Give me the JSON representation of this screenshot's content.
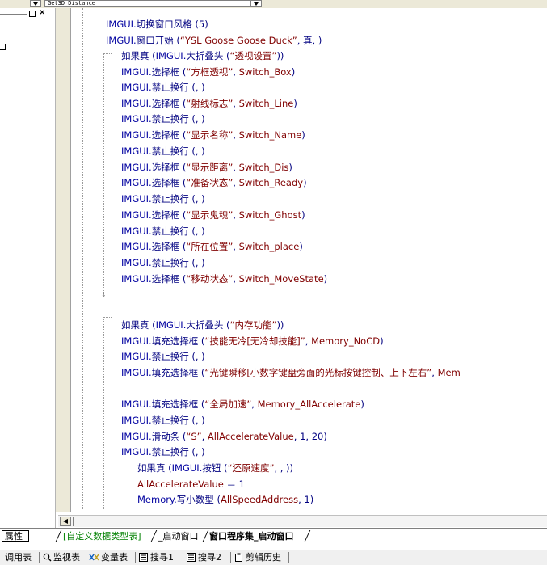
{
  "topbar": {
    "dropdown_value": "Get3D_Distance"
  },
  "left_panel": {
    "pin": "▫",
    "close": "×"
  },
  "code": [
    {
      "segments": [
        [
          "IMGUI.",
          "kw"
        ],
        [
          "切换窗口风格 (",
          "cn"
        ],
        [
          "5",
          "num"
        ],
        [
          ")",
          "cn"
        ]
      ]
    },
    {
      "segments": [
        [
          "IMGUI.",
          "kw"
        ],
        [
          "窗口开始 (",
          "cn"
        ],
        [
          "“YSL Goose Goose Duck”",
          "str"
        ],
        [
          ", ",
          "cn"
        ],
        [
          "真",
          "cn"
        ],
        [
          ", )",
          "cn"
        ]
      ]
    },
    {
      "segments": [
        [
          "如果真 (",
          "cn"
        ],
        [
          "IMGUI.",
          "kw"
        ],
        [
          "大折叠头 (",
          "cn"
        ],
        [
          "“透视设置”",
          "str"
        ],
        [
          "))",
          "cn"
        ]
      ]
    },
    {
      "segments": [
        [
          "IMGUI.",
          "kw"
        ],
        [
          "选择框 (",
          "cn"
        ],
        [
          "“方框透视”",
          "str"
        ],
        [
          ", ",
          "cn"
        ],
        [
          "Switch_Box",
          "var"
        ],
        [
          ")",
          "cn"
        ]
      ]
    },
    {
      "segments": [
        [
          "IMGUI.",
          "kw"
        ],
        [
          "禁止换行 (, )",
          "cn"
        ]
      ]
    },
    {
      "segments": [
        [
          "IMGUI.",
          "kw"
        ],
        [
          "选择框 (",
          "cn"
        ],
        [
          "“射线标志”",
          "str"
        ],
        [
          ", ",
          "cn"
        ],
        [
          "Switch_Line",
          "var"
        ],
        [
          ")",
          "cn"
        ]
      ]
    },
    {
      "segments": [
        [
          "IMGUI.",
          "kw"
        ],
        [
          "禁止换行 (, )",
          "cn"
        ]
      ]
    },
    {
      "segments": [
        [
          "IMGUI.",
          "kw"
        ],
        [
          "选择框 (",
          "cn"
        ],
        [
          "“显示名称”",
          "str"
        ],
        [
          ", ",
          "cn"
        ],
        [
          "Switch_Name",
          "var"
        ],
        [
          ")",
          "cn"
        ]
      ]
    },
    {
      "segments": [
        [
          "IMGUI.",
          "kw"
        ],
        [
          "禁止换行 (, )",
          "cn"
        ]
      ]
    },
    {
      "segments": [
        [
          "IMGUI.",
          "kw"
        ],
        [
          "选择框 (",
          "cn"
        ],
        [
          "“显示距离”",
          "str"
        ],
        [
          ", ",
          "cn"
        ],
        [
          "Switch_Dis",
          "var"
        ],
        [
          ")",
          "cn"
        ]
      ]
    },
    {
      "segments": [
        [
          "IMGUI.",
          "kw"
        ],
        [
          "选择框 (",
          "cn"
        ],
        [
          "“准备状态”",
          "str"
        ],
        [
          ", ",
          "cn"
        ],
        [
          "Switch_Ready",
          "var"
        ],
        [
          ")",
          "cn"
        ]
      ]
    },
    {
      "segments": [
        [
          "IMGUI.",
          "kw"
        ],
        [
          "禁止换行 (, )",
          "cn"
        ]
      ]
    },
    {
      "segments": [
        [
          "IMGUI.",
          "kw"
        ],
        [
          "选择框 (",
          "cn"
        ],
        [
          "“显示鬼魂”",
          "str"
        ],
        [
          ", ",
          "cn"
        ],
        [
          "Switch_Ghost",
          "var"
        ],
        [
          ")",
          "cn"
        ]
      ]
    },
    {
      "segments": [
        [
          "IMGUI.",
          "kw"
        ],
        [
          "禁止换行 (, )",
          "cn"
        ]
      ]
    },
    {
      "segments": [
        [
          "IMGUI.",
          "kw"
        ],
        [
          "选择框 (",
          "cn"
        ],
        [
          "“所在位置”",
          "str"
        ],
        [
          ", ",
          "cn"
        ],
        [
          "Switch_place",
          "var"
        ],
        [
          ")",
          "cn"
        ]
      ]
    },
    {
      "segments": [
        [
          "IMGUI.",
          "kw"
        ],
        [
          "禁止换行 (, )",
          "cn"
        ]
      ]
    },
    {
      "segments": [
        [
          "IMGUI.",
          "kw"
        ],
        [
          "选择框 (",
          "cn"
        ],
        [
          "“移动状态”",
          "str"
        ],
        [
          ", ",
          "cn"
        ],
        [
          "Switch_MoveState",
          "var"
        ],
        [
          ")",
          "cn"
        ]
      ]
    },
    {
      "segments": [
        [
          "如果真 (",
          "cn"
        ],
        [
          "IMGUI.",
          "kw"
        ],
        [
          "大折叠头 (",
          "cn"
        ],
        [
          "“内存功能”",
          "str"
        ],
        [
          "))",
          "cn"
        ]
      ]
    },
    {
      "segments": [
        [
          "IMGUI.",
          "kw"
        ],
        [
          "填充选择框 (",
          "cn"
        ],
        [
          "“技能无冷[无冷却技能]”",
          "str"
        ],
        [
          ", ",
          "cn"
        ],
        [
          "Memory_NoCD",
          "var"
        ],
        [
          ")",
          "cn"
        ]
      ]
    },
    {
      "segments": [
        [
          "IMGUI.",
          "kw"
        ],
        [
          "禁止换行 (, )",
          "cn"
        ]
      ]
    },
    {
      "segments": [
        [
          "IMGUI.",
          "kw"
        ],
        [
          "填充选择框 (",
          "cn"
        ],
        [
          "“光键瞬移[小数字键盘旁面的光标按键控制、上下左右”",
          "str"
        ],
        [
          ", ",
          "cn"
        ],
        [
          "Mem",
          "var"
        ]
      ]
    },
    {
      "segments": [
        [
          "IMGUI.",
          "kw"
        ],
        [
          "填充选择框 (",
          "cn"
        ],
        [
          "“全局加速”",
          "str"
        ],
        [
          ", ",
          "cn"
        ],
        [
          "Memory_AllAccelerate",
          "var"
        ],
        [
          ")",
          "cn"
        ]
      ]
    },
    {
      "segments": [
        [
          "IMGUI.",
          "kw"
        ],
        [
          "禁止换行 (, )",
          "cn"
        ]
      ]
    },
    {
      "segments": [
        [
          "IMGUI.",
          "kw"
        ],
        [
          "滑动条 (",
          "cn"
        ],
        [
          "“S”",
          "str"
        ],
        [
          ", ",
          "cn"
        ],
        [
          "AllAccelerateValue",
          "var"
        ],
        [
          ", ",
          "cn"
        ],
        [
          "1",
          "num"
        ],
        [
          ", ",
          "cn"
        ],
        [
          "20",
          "num"
        ],
        [
          ")",
          "cn"
        ]
      ]
    },
    {
      "segments": [
        [
          "IMGUI.",
          "kw"
        ],
        [
          "禁止换行 (, )",
          "cn"
        ]
      ]
    },
    {
      "segments": [
        [
          "如果真 (",
          "cn"
        ],
        [
          "IMGUI.",
          "kw"
        ],
        [
          "按钮 (",
          "cn"
        ],
        [
          "“还原速度”",
          "str"
        ],
        [
          ", , ))",
          "cn"
        ]
      ]
    },
    {
      "segments": [
        [
          "AllAccelerateValue",
          "var"
        ],
        [
          " ＝ ",
          "cn"
        ],
        [
          "1",
          "num"
        ]
      ]
    },
    {
      "segments": [
        [
          "Memory.",
          "kw"
        ],
        [
          "写小数型 (",
          "cn"
        ],
        [
          "AllSpeedAddress",
          "var"
        ],
        [
          ", ",
          "cn"
        ],
        [
          "1",
          "num"
        ],
        [
          ")",
          "cn"
        ]
      ]
    }
  ],
  "tabs": {
    "properties": "属性",
    "items": [
      "[自定义数据类型表]",
      "_启动窗口",
      "窗口程序集_启动窗口"
    ]
  },
  "bottom_bar": {
    "items": [
      "调用表",
      "监视表",
      "变量表",
      "搜寻1",
      "搜寻2",
      "剪辑历史"
    ]
  }
}
